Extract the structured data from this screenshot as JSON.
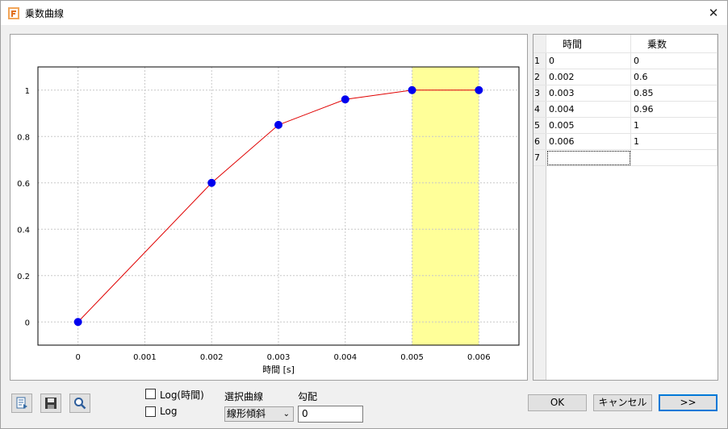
{
  "window": {
    "title": "乗数曲線",
    "app_icon": "app-logo-icon",
    "close_glyph": "✕"
  },
  "chart_data": {
    "type": "line",
    "x": [
      0,
      0.002,
      0.003,
      0.004,
      0.005,
      0.006
    ],
    "y": [
      0,
      0.6,
      0.85,
      0.96,
      1,
      1
    ],
    "xticks": [
      "0",
      "0.001",
      "0.002",
      "0.003",
      "0.004",
      "0.005",
      "0.006"
    ],
    "yticks": [
      "0",
      "0.2",
      "0.4",
      "0.6",
      "0.8",
      "1"
    ],
    "xlabel": "時間 [s]",
    "ylabel": "",
    "xlim": [
      -0.0006,
      0.0066
    ],
    "ylim": [
      -0.1,
      1.1
    ],
    "grid": true,
    "highlight_x_range": [
      0.005,
      0.006
    ],
    "colors": {
      "line": "#e00000",
      "marker": "#0000ee",
      "highlight": "#ffff99",
      "grid": "#c8c8c8"
    }
  },
  "table": {
    "columns": [
      "時間",
      "乗数"
    ],
    "rows": [
      {
        "num": "1",
        "time": "0",
        "mult": "0"
      },
      {
        "num": "2",
        "time": "0.002",
        "mult": "0.6"
      },
      {
        "num": "3",
        "time": "0.003",
        "mult": "0.85"
      },
      {
        "num": "4",
        "time": "0.004",
        "mult": "0.96"
      },
      {
        "num": "5",
        "time": "0.005",
        "mult": "1"
      },
      {
        "num": "6",
        "time": "0.006",
        "mult": "1"
      },
      {
        "num": "7",
        "time": "",
        "mult": ""
      }
    ]
  },
  "toolbar": {
    "icons": [
      "export-icon",
      "save-icon",
      "zoom-icon"
    ]
  },
  "options": {
    "log_time_label": "Log(時間)",
    "log_label": "Log",
    "log_time_checked": false,
    "log_checked": false,
    "curve_select_label": "選択曲線",
    "curve_select_value": "線形傾斜",
    "gradient_label": "勾配",
    "gradient_value": "0"
  },
  "buttons": {
    "ok": "OK",
    "cancel": "キャンセル",
    "next": ">>"
  }
}
